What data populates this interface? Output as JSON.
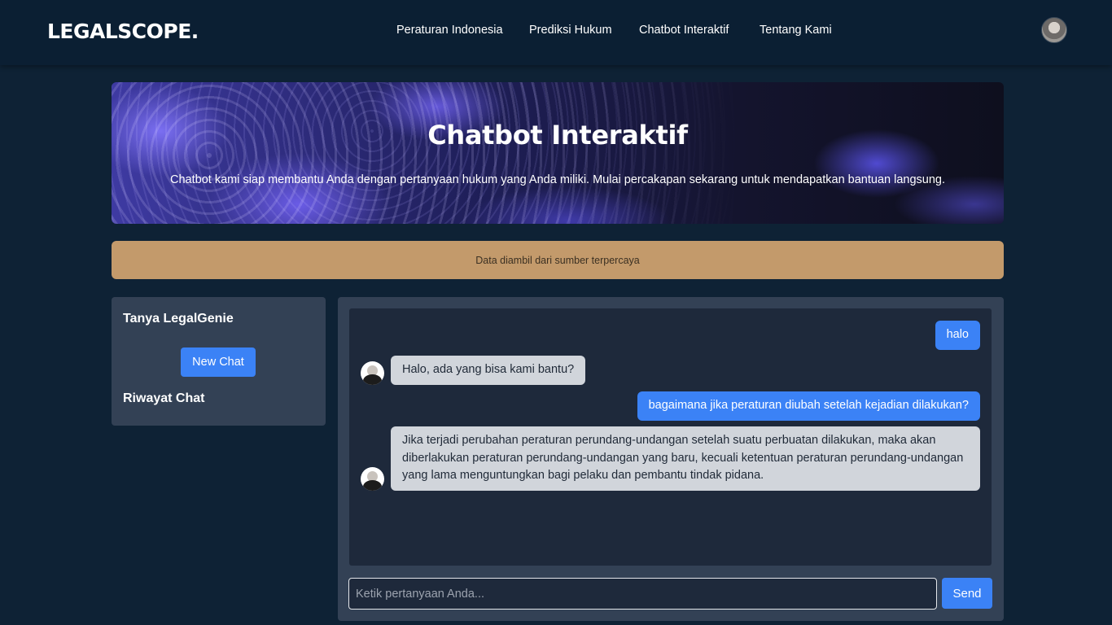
{
  "navbar": {
    "logo": "LEGALSCOPE.",
    "links": [
      {
        "label": "Peraturan Indonesia"
      },
      {
        "label": "Prediksi Hukum"
      },
      {
        "label": "Chatbot Interaktif"
      },
      {
        "label": "Tentang Kami"
      }
    ]
  },
  "hero": {
    "title": "Chatbot Interaktif",
    "subtitle": "Chatbot kami siap membantu Anda dengan pertanyaan hukum yang Anda miliki. Mulai percakapan sekarang untuk mendapatkan bantuan langsung."
  },
  "notice": {
    "text": "Data diambil dari sumber terpercaya"
  },
  "sidebar": {
    "title": "Tanya LegalGenie",
    "new_chat_label": "New Chat",
    "history_title": "Riwayat Chat"
  },
  "chat": {
    "messages": [
      {
        "role": "user",
        "text": "halo"
      },
      {
        "role": "bot",
        "text": "Halo, ada yang bisa kami bantu?"
      },
      {
        "role": "user",
        "text": "bagaimana jika peraturan diubah setelah kejadian dilakukan?"
      },
      {
        "role": "bot",
        "text": "Jika terjadi perubahan peraturan perundang-undangan setelah suatu perbuatan dilakukan, maka akan diberlakukan peraturan perundang-undangan yang baru, kecuali ketentuan peraturan perundang-undangan yang lama menguntungkan bagi pelaku dan pembantu tindak pidana."
      }
    ],
    "input_placeholder": "Ketik pertanyaan Anda...",
    "input_value": "",
    "send_label": "Send"
  },
  "colors": {
    "background": "#0e2235",
    "navbar": "#0b1f33",
    "accent": "#3b82f6",
    "notice": "#c39a6b",
    "panel": "#334155",
    "chat_area": "#1e293b",
    "bot_bubble": "#d1d5db"
  },
  "icons": {
    "user_avatar": "user-avatar-icon",
    "bot_avatar": "bot-avatar-icon"
  }
}
